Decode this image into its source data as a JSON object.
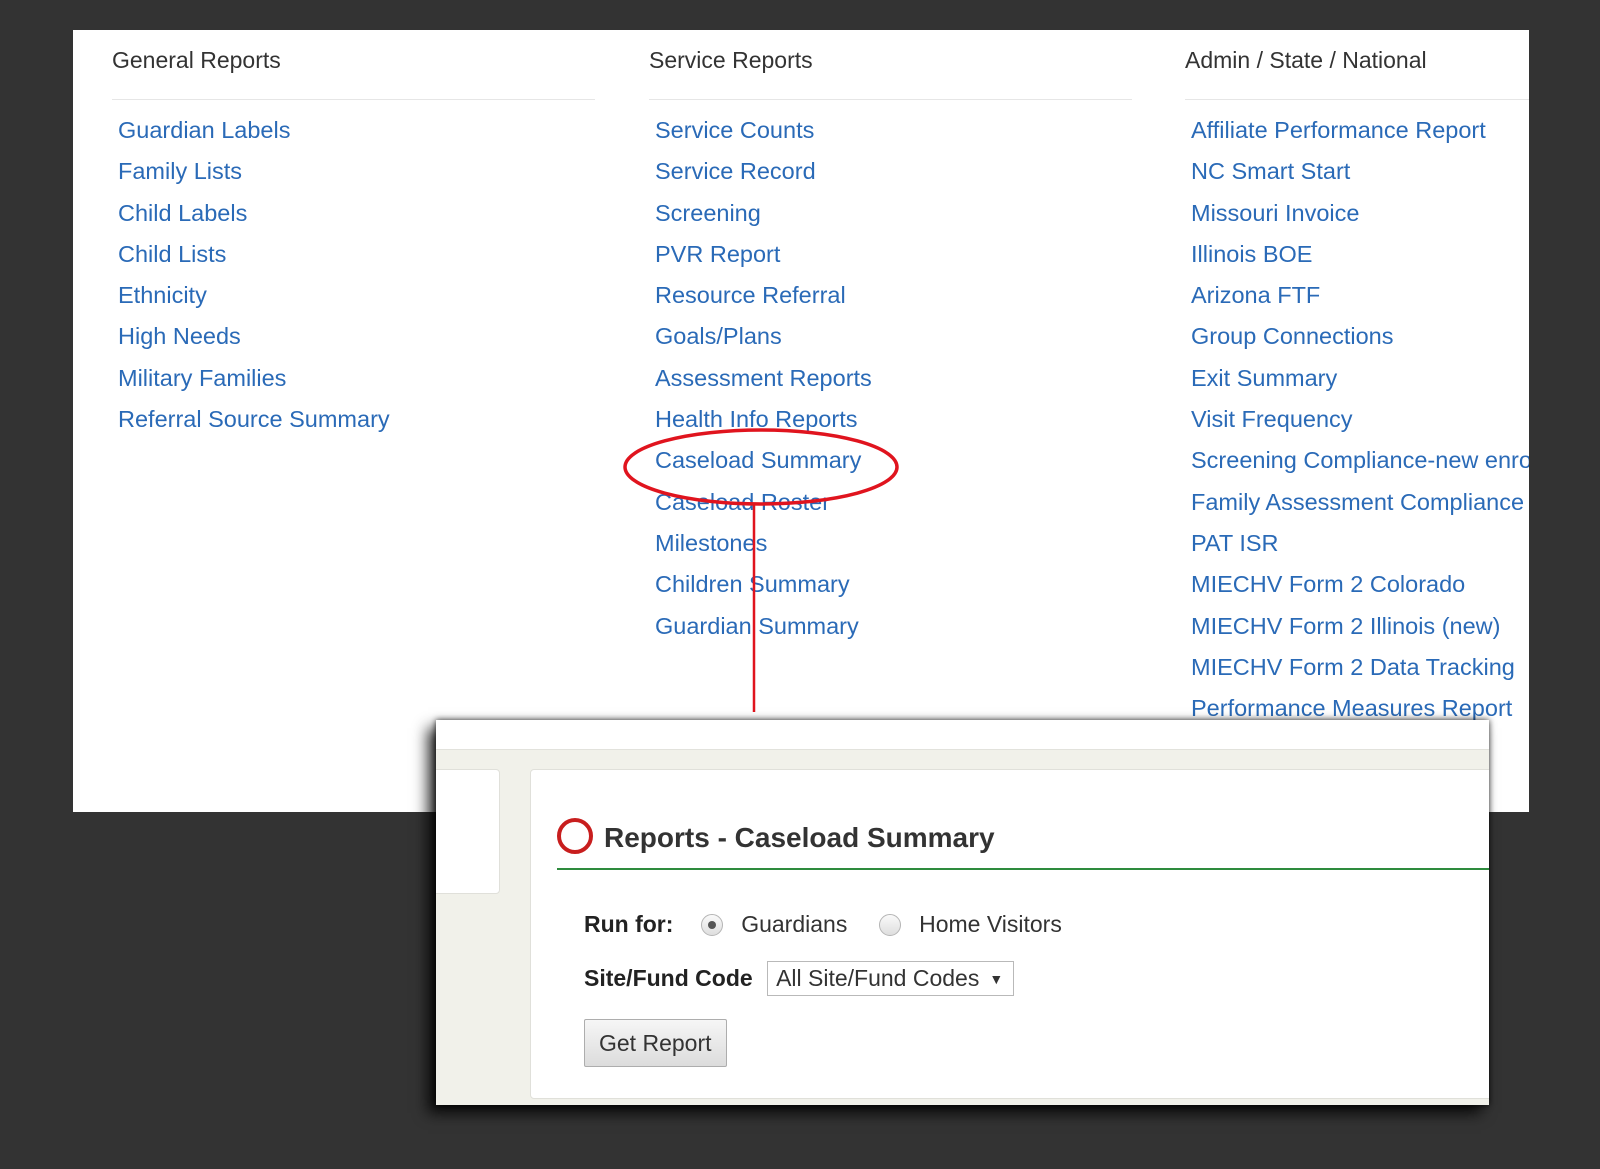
{
  "menu": {
    "columns": [
      {
        "heading": "General Reports",
        "links": [
          "Guardian Labels",
          "Family Lists",
          "Child Labels",
          "Child Lists",
          "Ethnicity",
          "High Needs",
          "Military Families",
          "Referral Source Summary"
        ]
      },
      {
        "heading": "Service Reports",
        "links": [
          "Service Counts",
          "Service Record",
          "Screening",
          "PVR Report",
          "Resource Referral",
          "Goals/Plans",
          "Assessment Reports",
          "Health Info Reports",
          "Caseload Summary",
          "Caseload Roster",
          "Milestones",
          "Children Summary",
          "Guardian Summary"
        ]
      },
      {
        "heading": "Admin / State / National",
        "links": [
          "Affiliate Performance Report",
          "NC Smart Start",
          "Missouri Invoice",
          "Illinois BOE",
          "Arizona FTF",
          "Group Connections",
          "Exit Summary",
          "Visit Frequency",
          "Screening Compliance-new enrollees",
          "Family Assessment Compliance",
          "PAT ISR",
          "MIECHV Form 2 Colorado",
          "MIECHV Form 2 Illinois (new)",
          "MIECHV Form 2 Data Tracking",
          "Performance Measures Report"
        ]
      }
    ]
  },
  "highlighted_link": "Caseload Summary",
  "colors": {
    "link": "#2a6ab7",
    "highlight_ring": "#e0141e",
    "title_rule": "#2e8b3e",
    "background": "#333333"
  },
  "report_form": {
    "title": "Reports - Caseload Summary",
    "run_for_label": "Run for:",
    "options": [
      "Guardians",
      "Home Visitors"
    ],
    "selected_option": "Guardians",
    "site_fund_label": "Site/Fund Code",
    "site_fund_value": "All Site/Fund Codes",
    "submit_label": "Get Report"
  }
}
